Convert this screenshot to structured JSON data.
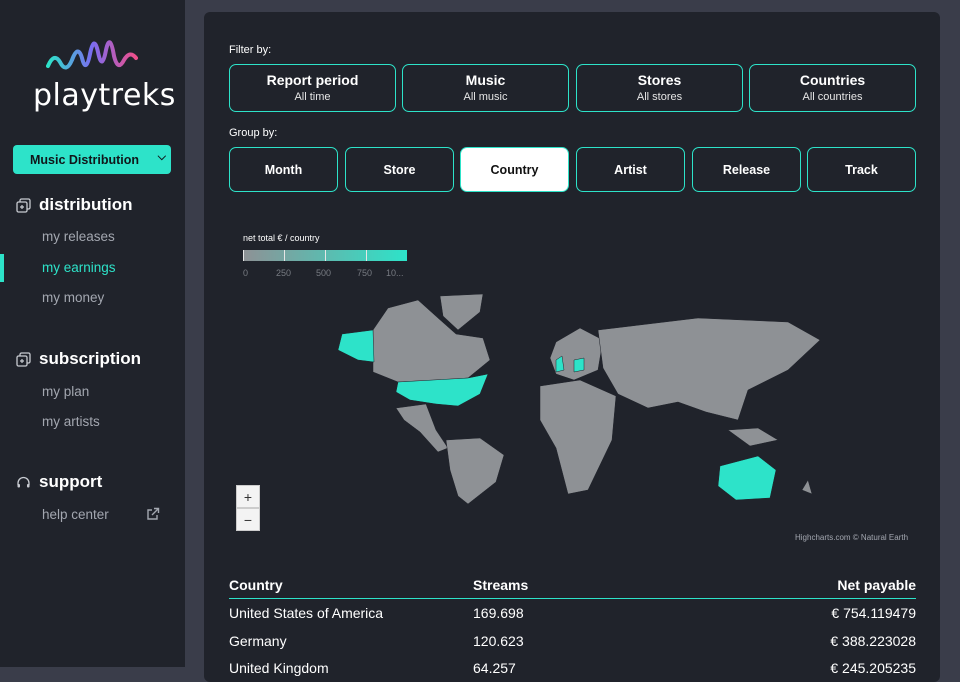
{
  "brand": {
    "name": "playtreks"
  },
  "sidebar": {
    "selector_label": "Music Distribution",
    "sections": [
      {
        "title": "distribution",
        "items": [
          "my releases",
          "my earnings",
          "my money"
        ]
      },
      {
        "title": "subscription",
        "items": [
          "my plan",
          "my artists"
        ]
      },
      {
        "title": "support",
        "items": [
          "help center"
        ]
      }
    ],
    "active_item": "my earnings"
  },
  "filters": {
    "label": "Filter by:",
    "items": [
      {
        "title": "Report period",
        "value": "All time"
      },
      {
        "title": "Music",
        "value": "All music"
      },
      {
        "title": "Stores",
        "value": "All stores"
      },
      {
        "title": "Countries",
        "value": "All countries"
      }
    ]
  },
  "group": {
    "label": "Group by:",
    "items": [
      "Month",
      "Store",
      "Country",
      "Artist",
      "Release",
      "Track"
    ],
    "active": "Country"
  },
  "map": {
    "legend_title": "net total € / country",
    "legend_labels": [
      "0",
      "250",
      "500",
      "750",
      "10..."
    ],
    "zoom_in": "+",
    "zoom_out": "−",
    "credits": "Highcharts.com © Natural Earth",
    "colors": {
      "low": "#8e9195",
      "high": "#2de3c9"
    }
  },
  "table": {
    "headers": [
      "Country",
      "Streams",
      "Net payable"
    ],
    "rows": [
      [
        "United States of America",
        "169.698",
        "€ 754.119479"
      ],
      [
        "Germany",
        "120.623",
        "€ 388.223028"
      ],
      [
        "United Kingdom",
        "64.257",
        "€ 245.205235"
      ]
    ]
  },
  "colors": {
    "accent": "#2de3c9",
    "panel": "#20232b",
    "background": "#3a3d4a"
  }
}
